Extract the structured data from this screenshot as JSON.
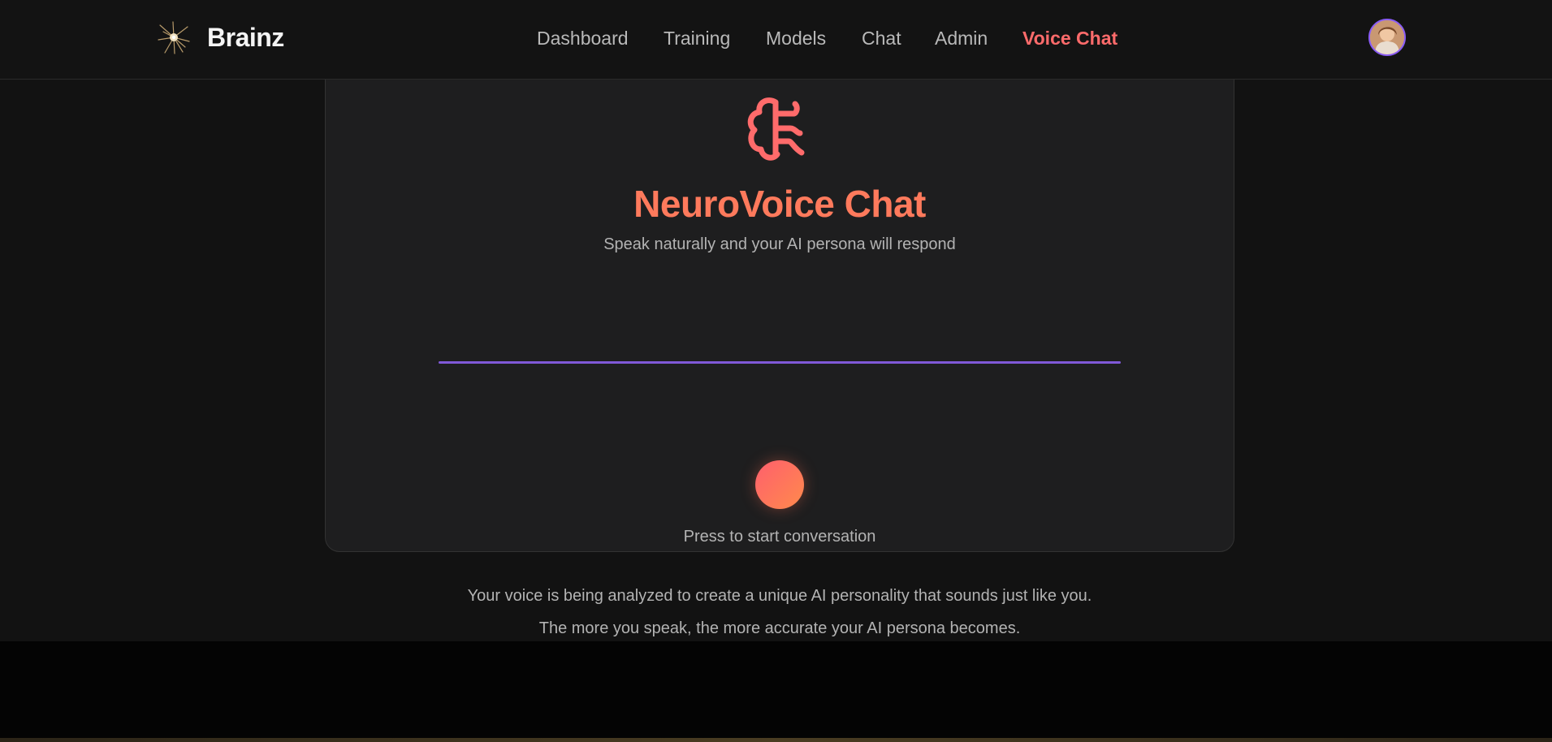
{
  "header": {
    "brand": "Brainz",
    "logo_icon": "neuron-icon",
    "nav": [
      {
        "label": "Dashboard",
        "active": false
      },
      {
        "label": "Training",
        "active": false
      },
      {
        "label": "Models",
        "active": false
      },
      {
        "label": "Chat",
        "active": false
      },
      {
        "label": "Admin",
        "active": false
      },
      {
        "label": "Voice Chat",
        "active": true
      }
    ],
    "avatar_icon": "user-avatar"
  },
  "card": {
    "icon": "brain-icon",
    "title": "NeuroVoice Chat",
    "subtitle": "Speak naturally and your AI persona will respond",
    "record_hint": "Press to start conversation"
  },
  "info": {
    "line1": "Your voice is being analyzed to create a unique AI personality that sounds just like you.",
    "line2": "The more you speak, the more accurate your AI persona becomes."
  },
  "colors": {
    "accent": "#ff6b6b",
    "title_gradient_end": "#ff8a4c",
    "waveform": "#8059d8",
    "avatar_border": "#8a5cf6",
    "background": "#121212",
    "card": "#1e1e1f"
  }
}
